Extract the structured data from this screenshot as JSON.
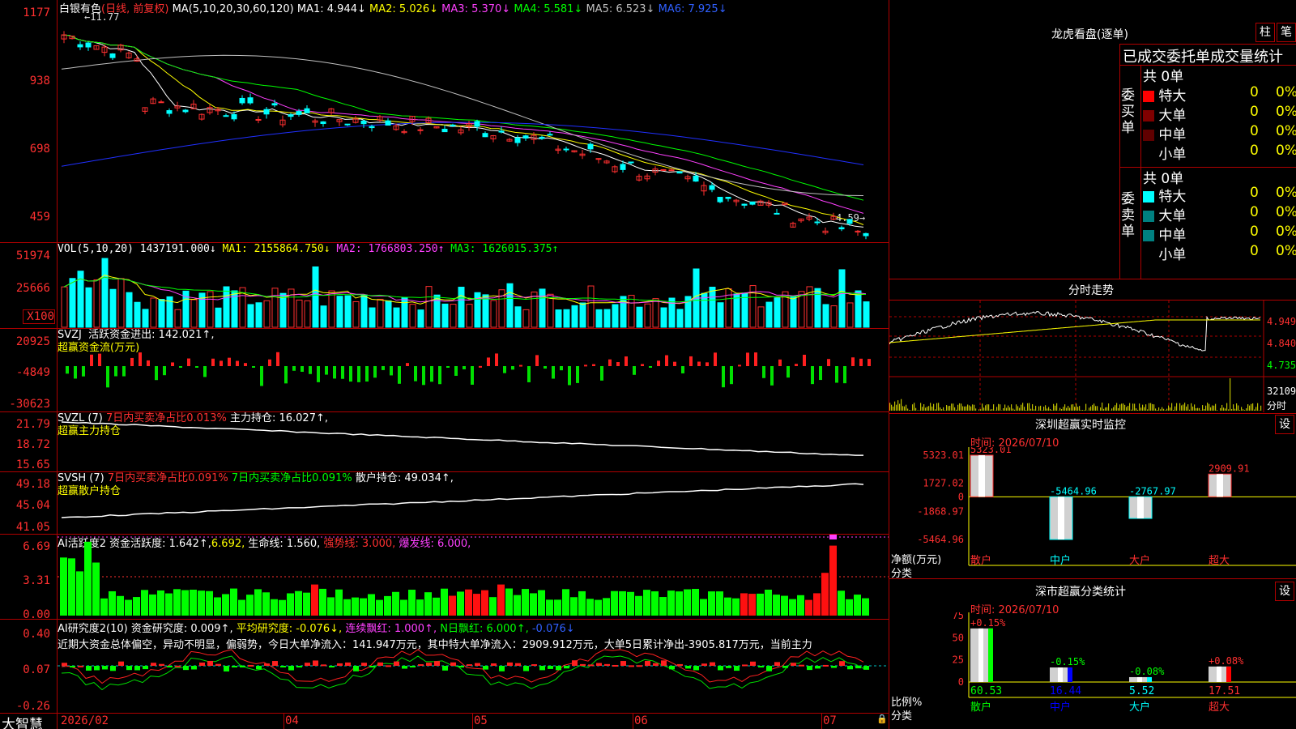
{
  "main": {
    "title": "白银有色",
    "period": "(日线, 前复权)",
    "ma_header": "MA(5,10,20,30,60,120)",
    "ma": [
      {
        "label": "MA1:",
        "value": "4.944↓",
        "color": "#ffffff"
      },
      {
        "label": "MA2:",
        "value": "5.026↓",
        "color": "#ffff00"
      },
      {
        "label": "MA3:",
        "value": "5.370↓",
        "color": "#ff40ff"
      },
      {
        "label": "MA4:",
        "value": "5.581↓",
        "color": "#00ff00"
      },
      {
        "label": "MA5:",
        "value": "6.523↓",
        "color": "#c0c0c0"
      },
      {
        "label": "MA6:",
        "value": "7.925↓",
        "color": "#3060ff"
      }
    ],
    "y_labels": [
      "1177",
      "938",
      "698",
      "459"
    ],
    "high_marker": "11.77",
    "low_marker": "4.59"
  },
  "vol": {
    "header": "VOL(5,10,20)",
    "value": "1437191.000↓",
    "ma1": "MA1: 2155864.750↓",
    "ma2": "MA2: 1766803.250↑",
    "ma3": "MA3: 1626015.375↑",
    "y_labels": [
      "51974",
      "25666",
      "X100"
    ]
  },
  "svzj": {
    "header": "SVZJ",
    "line1": "活跃资金进出: 142.021↑,",
    "line2": "超赢资金流(万元)",
    "y_labels": [
      "20925",
      "-4849",
      "-30623"
    ]
  },
  "svzl": {
    "header": "SVZL (7)",
    "ratio": "7日内买卖净占比0.013%",
    "hold": "主力持仓: 16.027↑,",
    "line2": "超赢主力持仓",
    "y_labels": [
      "21.79",
      "18.72",
      "15.65"
    ]
  },
  "svsh": {
    "header": "SVSH (7)",
    "ratio1": "7日内买卖净占比0.091%",
    "ratio2": "7日内买卖净占比0.091%",
    "hold": "散户持仓: 49.034↑,",
    "line2": "超赢散户持仓",
    "y_labels": [
      "49.18",
      "45.04",
      "41.05"
    ]
  },
  "ai_act": {
    "header": "AI活跃度2",
    "a1": "资金活跃度: 1.642↑,",
    "a2": "6.692,",
    "a3": "生命线: 1.560,",
    "a4": "强势线: 3.000,",
    "a5": "爆发线: 6.000,",
    "y_labels": [
      "6.69",
      "3.31",
      "0.00"
    ]
  },
  "ai_res": {
    "header": "AI研究度2(10)",
    "a1": "资金研究度: 0.009↑,",
    "a2": "平均研究度: -0.076↓,",
    "a3": "连续飘红: 1.000↑,",
    "a4": "N日飘红: 6.000↑,",
    "a5": "-0.076↓",
    "comment": "近期大资金总体偏空，异动不明显，偏弱势，今日大单净流入：141.947万元，其中特大单净流入：2909.912万元，大单5日累计净出-3905.817万元，当前主力",
    "y_labels": [
      "0.40",
      "0.07",
      "-0.26"
    ]
  },
  "bottom": {
    "brand": "大智慧",
    "dates": [
      "2026/02",
      "04",
      "05",
      "06",
      "07"
    ]
  },
  "right": {
    "longhu_title": "龙虎看盘(逐单)",
    "btn_zhu": "柱",
    "btn_bi": "笔",
    "stat_title": "已成交委托单成交量统计",
    "buy_label": "委买单",
    "sell_label": "委卖单",
    "buy_total": "共 0单",
    "sell_total": "共 0单",
    "buy_rows": [
      {
        "name": "特大",
        "count": "0",
        "pct": "0%",
        "color": "#ff0000"
      },
      {
        "name": "大单",
        "count": "0",
        "pct": "0%",
        "color": "#800000"
      },
      {
        "name": "中单",
        "count": "0",
        "pct": "0%",
        "color": "#600000"
      },
      {
        "name": "小单",
        "count": "0",
        "pct": "0%",
        "color": "#000000"
      }
    ],
    "sell_rows": [
      {
        "name": "特大",
        "count": "0",
        "pct": "0%",
        "color": "#00ffff"
      },
      {
        "name": "大单",
        "count": "0",
        "pct": "0%",
        "color": "#008080"
      },
      {
        "name": "中单",
        "count": "0",
        "pct": "0%",
        "color": "#008080"
      },
      {
        "name": "小单",
        "count": "0",
        "pct": "0%",
        "color": "#000000"
      }
    ],
    "fenshi_title": "分时走势",
    "fenshi_prices": [
      "4.949",
      "4.840",
      "4.735"
    ],
    "fenshi_vol": "32109",
    "fenshi_label": "分时",
    "monitor_title": "深圳超赢实时监控",
    "btn_she": "设",
    "monitor_time": "时间: 2026/07/10",
    "monitor_y": [
      "5323.01",
      "1727.02",
      "0",
      "-1868.97",
      "-5464.96"
    ],
    "monitor_ylabel": "净额(万元)",
    "monitor_xlabel": "分类",
    "monitor_bars": [
      {
        "name": "散户",
        "value": 5323.01,
        "label": "5323.01"
      },
      {
        "name": "中户",
        "value": -5464.96,
        "label": "-5464.96"
      },
      {
        "name": "大户",
        "value": -2767.97,
        "label": "-2767.97"
      },
      {
        "name": "超大",
        "value": 2909.91,
        "label": "2909.91"
      }
    ],
    "class_title": "深市超赢分类统计",
    "class_time": "时间: 2026/07/10",
    "class_y": [
      "75",
      "50",
      "25",
      "0"
    ],
    "class_ylabel": "比例%",
    "class_xlabel": "分类",
    "class_bars": [
      {
        "name": "散户",
        "value": 60.53,
        "label": "60.53",
        "chg": "+0.15%",
        "color": "#00ff00"
      },
      {
        "name": "中户",
        "value": 16.44,
        "label": "16.44",
        "chg": "-0.15%",
        "color": "#0000ff"
      },
      {
        "name": "大户",
        "value": 5.52,
        "label": "5.52",
        "chg": "-0.08%",
        "color": "#00ffff"
      },
      {
        "name": "超大",
        "value": 17.51,
        "label": "17.51",
        "chg": "+0.08%",
        "color": "#ff0000"
      }
    ]
  }
}
